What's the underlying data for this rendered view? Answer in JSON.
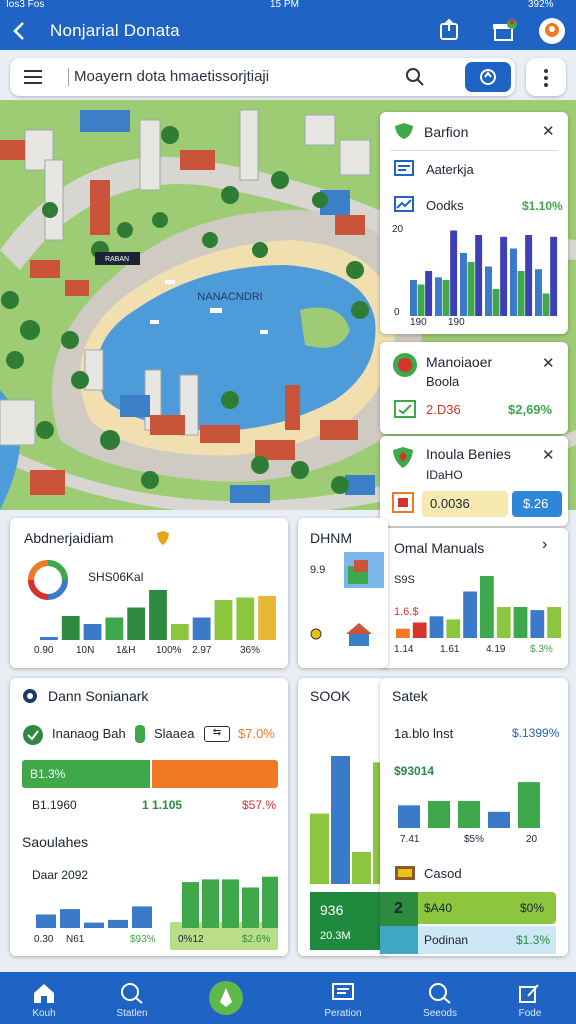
{
  "status": {
    "left": "Ios3 Fos",
    "time": "15 PM",
    "right": "392%"
  },
  "header": {
    "title": "Nonjarial Donata"
  },
  "search": {
    "placeholder": "Moayern dota hmaetissorjtiaji"
  },
  "map": {
    "label": "NANACNDRI",
    "pin_label": "RABAN"
  },
  "popups": {
    "p1": {
      "title": "Barfion",
      "row1": "Aaterkja",
      "row2_label": "Oodks",
      "row2_value": "$1.10%",
      "chart": {
        "type": "bar",
        "y_ticks": [
          "20",
          "0"
        ],
        "x_labels": [
          "190",
          "190"
        ],
        "series": [
          {
            "color": "#3b79c9",
            "values": [
              0.4,
              0.43,
              0.7,
              0.55,
              0.75,
              0.52
            ]
          },
          {
            "color": "#42a64b",
            "values": [
              0.35,
              0.4,
              0.6,
              0.3,
              0.5,
              0.25
            ]
          },
          {
            "color": "#3d3fb4",
            "values": [
              0.5,
              0.95,
              0.9,
              0.88,
              0.9,
              0.88
            ]
          }
        ]
      }
    },
    "p2": {
      "title": "Manoiaoer",
      "subtitle": "Boola",
      "value_red": "2.D36",
      "value_green": "$2,69%"
    },
    "p3": {
      "title": "Inoula Benies",
      "subtitle": "IDaHO",
      "value": "0.0036",
      "button": "$.26"
    },
    "p4": {
      "title": "Omal Manuals",
      "y_tick": "S9S",
      "y_tick2": "1.6.$",
      "x_labels": [
        "1.14",
        "1.61",
        "4.19",
        "$.3%"
      ],
      "chart": {
        "type": "bar",
        "values": [
          0.15,
          0.25,
          0.35,
          0.3,
          0.75,
          1.0,
          0.5,
          0.5,
          0.45,
          0.5
        ]
      }
    }
  },
  "cards": {
    "c1": {
      "title": "Abdnerjaidiam",
      "subtitle": "SHS06Kal",
      "x_labels": [
        "0.90",
        "10N",
        "1&H",
        "100%",
        "2.97",
        "36%"
      ],
      "chart": {
        "type": "bar",
        "values": [
          0.06,
          0.48,
          0.32,
          0.45,
          0.65,
          1.0,
          0.32,
          0.45,
          0.8,
          0.85,
          0.88
        ]
      }
    },
    "c2": {
      "title": "DHNM",
      "y_tick": "9.9"
    },
    "c3": {
      "title": "Dann Sonianark",
      "row_left": "Inanaog Bah",
      "row_mid": "Slaaea",
      "row_right": "$7.0%",
      "bar_label": "B1.3%",
      "stat1": "B1.1960",
      "stat2": "1 1.105",
      "stat3": "$57.%",
      "sub_title": "Saoulahes",
      "sub_label": "Daar 2092",
      "x_labels": [
        "0.30",
        "N61",
        "$93%",
        "0%12",
        "$2.6%"
      ],
      "chart": {
        "type": "bar",
        "values_left": [
          0.25,
          0.35,
          0.1,
          0.15,
          0.4
        ],
        "values_right": [
          0.85,
          0.9,
          0.9,
          0.75,
          0.95
        ]
      }
    },
    "c4": {
      "title": "SOOK",
      "bottom_left": "936",
      "bottom_left2": "20.3M",
      "chart": {
        "type": "bar",
        "values": [
          0.55,
          1.0,
          0.25,
          0.95
        ]
      }
    },
    "c5": {
      "title": "Satek",
      "row": "1a.blo lnst",
      "row_value": "$.1399%",
      "green_label": "$93014",
      "x_labels": [
        "7.41",
        "$5%",
        "20"
      ],
      "item1": "Casod",
      "item1_a": "$A40",
      "item1_b": "$0%",
      "item2": "Podinan",
      "item2_value": "$1.3%",
      "badge": "2",
      "chart": {
        "type": "bar",
        "values": [
          0.42,
          0.5,
          0.5,
          0.3,
          0.85
        ]
      }
    }
  },
  "nav": [
    {
      "label": "Kouh",
      "icon": "home-icon"
    },
    {
      "label": "Statlen",
      "icon": "search-icon"
    },
    {
      "label": "",
      "icon": "center-action-icon"
    },
    {
      "label": "Peration",
      "icon": "message-icon"
    },
    {
      "label": "Seeods",
      "icon": "search-icon"
    },
    {
      "label": "Fode",
      "icon": "edit-icon"
    }
  ],
  "colors": {
    "primary": "#1f63c4",
    "green": "#3ea84a",
    "orange": "#f07a24",
    "red": "#d6332b",
    "lime": "#8cc63f"
  }
}
